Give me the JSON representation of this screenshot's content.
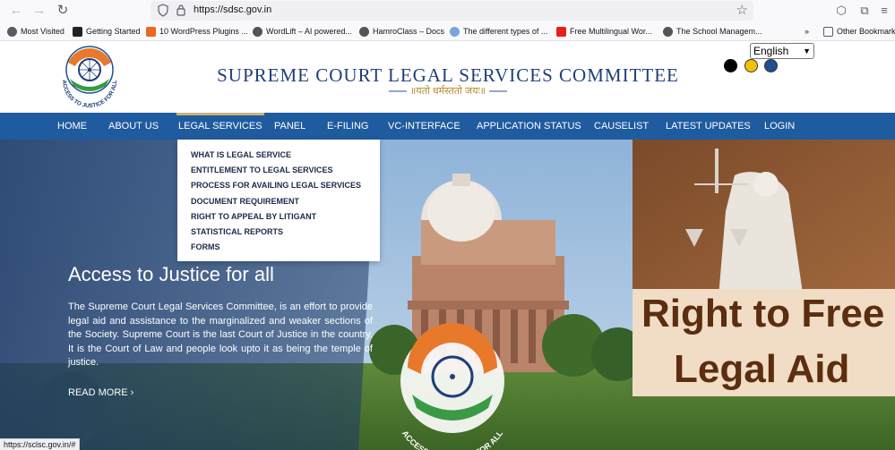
{
  "browser": {
    "url": "https://sdsc.gov.in",
    "bookmarks": [
      "Most Visited",
      "Getting Started",
      "10 WordPress Plugins ...",
      "WordLift – AI powered...",
      "HamroClass – Docs",
      "The different types of ...",
      "Free Multilingual Wor...",
      "The School Managem...",
      "Other Bookmarks"
    ],
    "status_url": "https://sclsc.gov.in/#"
  },
  "header": {
    "site_title": "SUPREME COURT LEGAL SERVICES COMMITTEE",
    "motto": "॥यतो धर्मस्ततो जयः॥",
    "language": "English",
    "contrast_colors": [
      "#000000",
      "#f2c200",
      "#1f4f8f"
    ]
  },
  "nav": {
    "items": [
      "HOME",
      "ABOUT US",
      "LEGAL SERVICES",
      "PANEL",
      "E-FILING",
      "VC-INTERFACE",
      "APPLICATION STATUS",
      "CAUSELIST",
      "LATEST UPDATES",
      "LOGIN"
    ],
    "active": "LEGAL SERVICES"
  },
  "dropdown": {
    "items": [
      "WHAT IS LEGAL SERVICE",
      "ENTITLEMENT TO LEGAL SERVICES",
      "PROCESS FOR AVAILING LEGAL SERVICES",
      "DOCUMENT REQUIREMENT",
      "RIGHT TO APPEAL BY LITIGANT",
      "STATISTICAL REPORTS",
      "FORMS"
    ]
  },
  "hero": {
    "title": "Access to Justice for all",
    "text": "The Supreme Court Legal Services Committee, is an effort to provide legal aid and assistance to the marginalized and weaker sections of the Society. Supreme Court is the last Court of Justice in the country. It is the Court of Law and people look upto it as being the temple of justice.",
    "read_more": "READ MORE ›",
    "emblem_text": "ACCESS TO JUSTICE FOR ALL"
  },
  "aid_panel": {
    "line1": "Right to Free",
    "line2": "Legal Aid"
  },
  "logo": {
    "text": "ACCESS TO JUSTICE FOR ALL"
  },
  "colors": {
    "navbar": "#1f5b9f",
    "title": "#1f3f7a",
    "aid_text": "#5c2d0f",
    "aid_bg": "#f1ddc6"
  }
}
